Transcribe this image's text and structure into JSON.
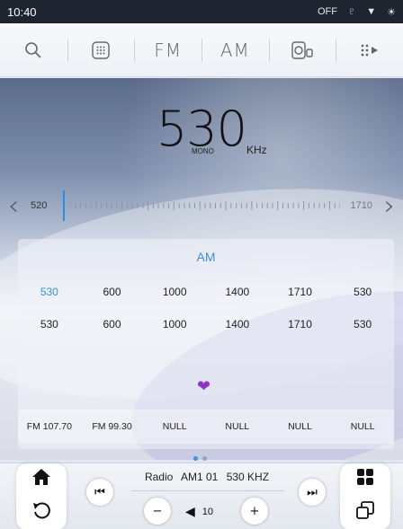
{
  "status": {
    "time": "10:40",
    "off_label": "OFF"
  },
  "toolbar": {
    "search_icon": "search-icon",
    "keypad_icon": "keypad-icon",
    "fm_label": "FM",
    "am_label": "AM",
    "speaker_icon": "speaker-icon",
    "more_icon": "more-icon"
  },
  "display": {
    "frequency": "530",
    "unit": "KHz",
    "mode": "MONO"
  },
  "tuner": {
    "low": "520",
    "high": "1710"
  },
  "presets": {
    "band": "AM",
    "row1": [
      "530",
      "600",
      "1000",
      "1400",
      "1710",
      "530"
    ],
    "row2": [
      "530",
      "600",
      "1000",
      "1400",
      "1710",
      "530"
    ],
    "favorites": [
      "FM 107.70",
      "FM 99.30",
      "NULL",
      "NULL",
      "NULL",
      "NULL"
    ]
  },
  "bottom": {
    "source": "Radio",
    "station": "AM1  01",
    "freq": "530 KHZ",
    "volume": "10"
  },
  "colors": {
    "accent": "#3d8fd6",
    "heart": "#8e35c6"
  }
}
